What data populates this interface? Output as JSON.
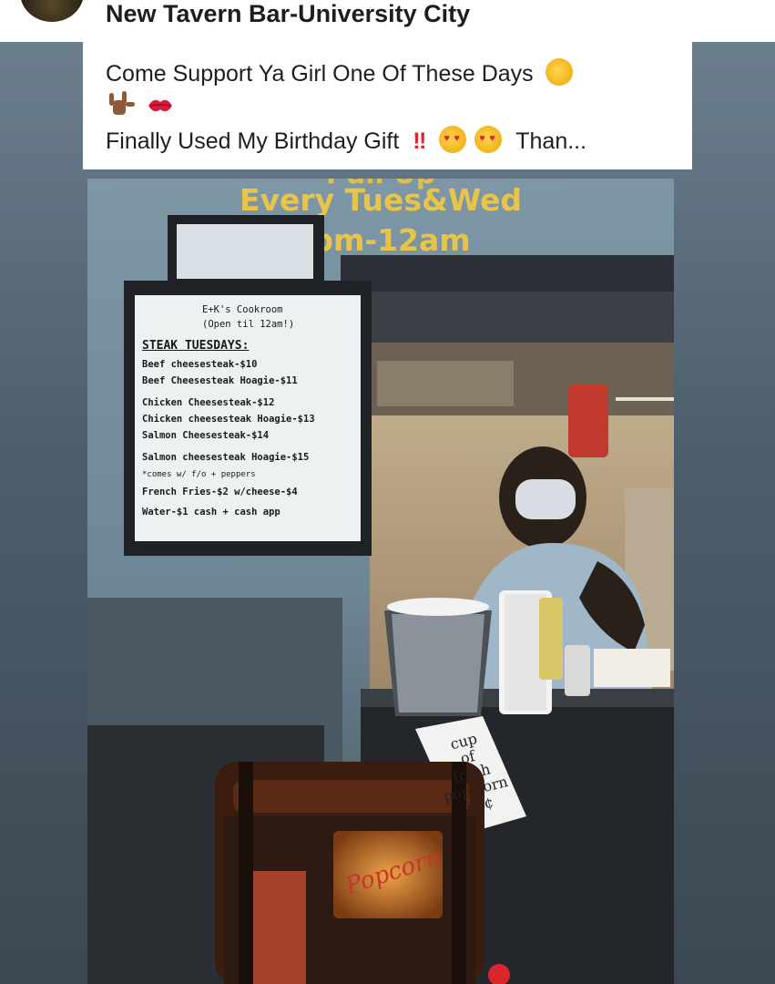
{
  "header": {
    "page_name": "New Tavern Bar-University City"
  },
  "caption": {
    "line1": "Come Support Ya Girl One Of These Days",
    "line3": "Finally Used My Birthday Gift",
    "line3_more": "Than..."
  },
  "photo": {
    "overlay_line1": "Every Tues&Wed",
    "overlay_line2": "7pm-12am",
    "menu": {
      "title": "E+K's Cookroom",
      "hours": "(Open til 12am!)",
      "heading": "STEAK TUESDAYS:",
      "items": [
        "Beef cheesesteak-$10",
        "Beef Cheesesteak Hoagie-$11",
        "Chicken Cheesesteak-$12",
        "Chicken cheesesteak Hoagie-$13",
        "Salmon Cheesesteak-$14",
        "Salmon cheesesteak Hoagie-$15",
        "*comes w/ f/o + peppers",
        "French Fries-$2 w/cheese-$4",
        "Water-$1   cash + cash app"
      ]
    },
    "sign_lines": [
      "cup",
      "of",
      "fresh",
      "pop-corn",
      "50¢"
    ],
    "popcorn_label": "Popcorn"
  },
  "colors": {
    "overlay_text": "#e8c548",
    "text_primary": "#1c1e21"
  }
}
